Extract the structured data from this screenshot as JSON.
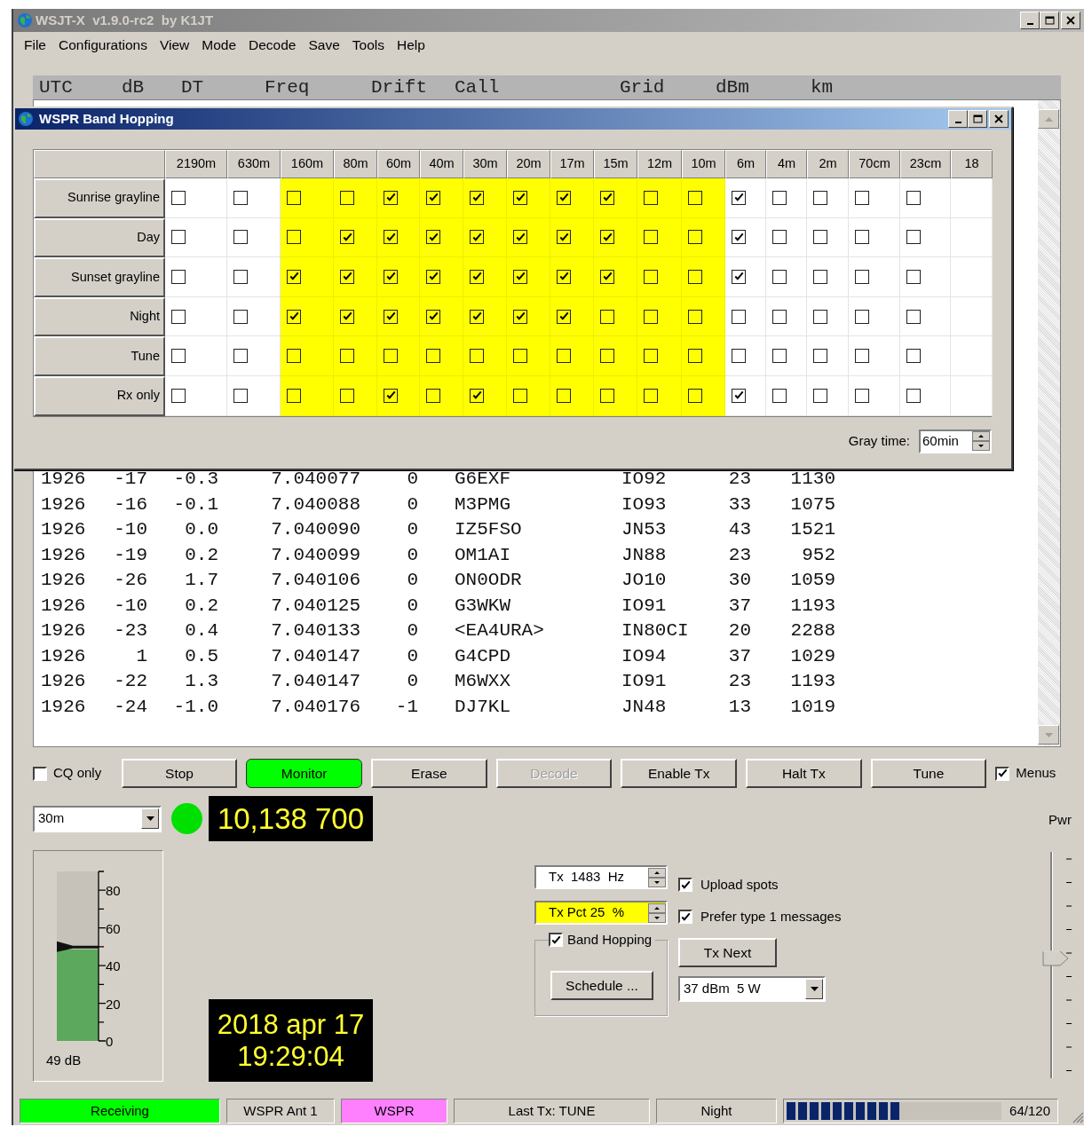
{
  "window": {
    "title": "WSJT-X  v1.9.0-rc2  by K1JT"
  },
  "menu": [
    "File",
    "Configurations",
    "View",
    "Mode",
    "Decode",
    "Save",
    "Tools",
    "Help"
  ],
  "decode": {
    "columns": [
      "UTC",
      "dB",
      "DT",
      "Freq",
      "Drift",
      "Call",
      "Grid",
      "dBm",
      "km"
    ],
    "rows": [
      [
        "1926",
        "-17",
        "-0.3",
        "7.040077",
        "0",
        "G6EXF",
        "IO92",
        "23",
        "1130"
      ],
      [
        "1926",
        "-16",
        "-0.1",
        "7.040088",
        "0",
        "M3PMG",
        "IO93",
        "33",
        "1075"
      ],
      [
        "1926",
        "-10",
        "0.0",
        "7.040090",
        "0",
        "IZ5FSO",
        "JN53",
        "43",
        "1521"
      ],
      [
        "1926",
        "-19",
        "0.2",
        "7.040099",
        "0",
        "OM1AI",
        "JN88",
        "23",
        "952"
      ],
      [
        "1926",
        "-26",
        "1.7",
        "7.040106",
        "0",
        "ON0ODR",
        "JO10",
        "30",
        "1059"
      ],
      [
        "1926",
        "-10",
        "0.2",
        "7.040125",
        "0",
        "G3WKW",
        "IO91",
        "37",
        "1193"
      ],
      [
        "1926",
        "-23",
        "0.4",
        "7.040133",
        "0",
        "<EA4URA>",
        "IN80CI",
        "20",
        "2288"
      ],
      [
        "1926",
        "1",
        "0.5",
        "7.040147",
        "0",
        "G4CPD",
        "IO94",
        "37",
        "1029"
      ],
      [
        "1926",
        "-22",
        "1.3",
        "7.040147",
        "0",
        "M6WXX",
        "IO91",
        "23",
        "1193"
      ],
      [
        "1926",
        "-24",
        "-1.0",
        "7.040176",
        "-1",
        "DJ7KL",
        "JN48",
        "13",
        "1019"
      ]
    ]
  },
  "band_hopping": {
    "title": "WSPR Band Hopping",
    "bands": [
      {
        "label": "2190m",
        "highlighted": false
      },
      {
        "label": "630m",
        "highlighted": false
      },
      {
        "label": "160m",
        "highlighted": true
      },
      {
        "label": "80m",
        "highlighted": true
      },
      {
        "label": "60m",
        "highlighted": true
      },
      {
        "label": "40m",
        "highlighted": true
      },
      {
        "label": "30m",
        "highlighted": true
      },
      {
        "label": "20m",
        "highlighted": true
      },
      {
        "label": "17m",
        "highlighted": true
      },
      {
        "label": "15m",
        "highlighted": true
      },
      {
        "label": "12m",
        "highlighted": true
      },
      {
        "label": "10m",
        "highlighted": true
      },
      {
        "label": "6m",
        "highlighted": false
      },
      {
        "label": "4m",
        "highlighted": false
      },
      {
        "label": "2m",
        "highlighted": false
      },
      {
        "label": "70cm",
        "highlighted": false
      },
      {
        "label": "23cm",
        "highlighted": false
      },
      {
        "label": "18",
        "highlighted": false
      }
    ],
    "periods": [
      {
        "label": "Sunrise grayline",
        "checks": [
          false,
          false,
          false,
          false,
          true,
          true,
          true,
          true,
          true,
          true,
          false,
          false,
          true,
          false,
          false,
          false,
          false
        ]
      },
      {
        "label": "Day",
        "checks": [
          false,
          false,
          false,
          true,
          true,
          true,
          true,
          true,
          true,
          true,
          false,
          false,
          true,
          false,
          false,
          false,
          false
        ]
      },
      {
        "label": "Sunset grayline",
        "checks": [
          false,
          false,
          true,
          true,
          true,
          true,
          true,
          true,
          true,
          true,
          false,
          false,
          true,
          false,
          false,
          false,
          false
        ]
      },
      {
        "label": "Night",
        "checks": [
          false,
          false,
          true,
          true,
          true,
          true,
          true,
          true,
          true,
          false,
          false,
          false,
          false,
          false,
          false,
          false,
          false
        ]
      },
      {
        "label": "Tune",
        "checks": [
          false,
          false,
          false,
          false,
          false,
          false,
          false,
          false,
          false,
          false,
          false,
          false,
          false,
          false,
          false,
          false,
          false
        ]
      },
      {
        "label": "Rx only",
        "checks": [
          false,
          false,
          false,
          false,
          true,
          false,
          true,
          false,
          false,
          false,
          false,
          false,
          true,
          false,
          false,
          false,
          false
        ]
      }
    ],
    "gray_time": {
      "label": "Gray time:",
      "value": "60min"
    }
  },
  "buttons": [
    {
      "kind": "checkbox",
      "label": "CQ only",
      "checked": false
    },
    {
      "kind": "button",
      "label": "Stop",
      "on": false,
      "disabled": false
    },
    {
      "kind": "button",
      "label": "Monitor",
      "on": true,
      "disabled": false
    },
    {
      "kind": "button",
      "label": "Erase",
      "on": false,
      "disabled": false
    },
    {
      "kind": "button",
      "label": "Decode",
      "on": false,
      "disabled": true
    },
    {
      "kind": "button",
      "label": "Enable Tx",
      "on": false,
      "disabled": false
    },
    {
      "kind": "button",
      "label": "Halt Tx",
      "on": false,
      "disabled": false
    },
    {
      "kind": "button",
      "label": "Tune",
      "on": false,
      "disabled": false
    },
    {
      "kind": "checkbox",
      "label": "Menus",
      "checked": true
    }
  ],
  "band_select": {
    "value": "30m"
  },
  "indicator": {
    "on": true
  },
  "frequency": "10,138 700",
  "meter": {
    "level": 0.54,
    "ticks": [
      "80",
      "60",
      "40",
      "20",
      "0"
    ],
    "reading": "49 dB"
  },
  "datetime": [
    "2018 apr 17",
    "19:29:04"
  ],
  "tx_freq": {
    "value": "Tx  1483  Hz",
    "highlighted": false
  },
  "tx_pct": {
    "value": "Tx Pct 25  %",
    "highlighted": true
  },
  "hopping_group": {
    "label": "Band Hopping",
    "checked": true,
    "button": "Schedule ..."
  },
  "options": [
    {
      "label": "Upload spots",
      "checked": true
    },
    {
      "label": "Prefer type 1 messages",
      "checked": true
    }
  ],
  "tx_next": "Tx Next",
  "power_select": {
    "value": "37 dBm  5 W"
  },
  "pwr": {
    "label": "Pwr",
    "level": 0.54
  },
  "status_bar": [
    {
      "kind": "text",
      "text": "Receiving",
      "color": "#00ff00"
    },
    {
      "kind": "text",
      "text": "WSPR Ant 1"
    },
    {
      "kind": "text",
      "text": "WSPR",
      "color": "#ff80ff"
    },
    {
      "kind": "text",
      "text": "Last Tx: TUNE"
    },
    {
      "kind": "text",
      "text": "Night"
    },
    {
      "kind": "progress",
      "level": 0.53,
      "text": "64/120"
    }
  ]
}
